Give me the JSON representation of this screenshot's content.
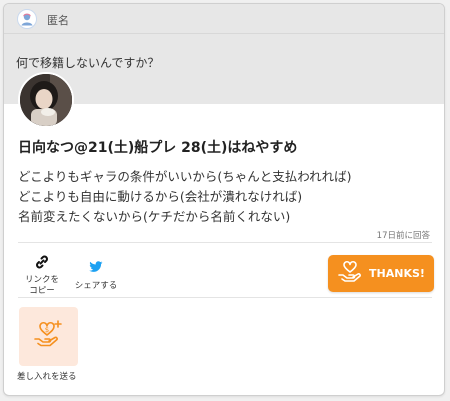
{
  "header": {
    "anonymous_name": "匿名",
    "avatar_icon": "anonymous-user-icon"
  },
  "question": {
    "text": "何で移籍しないんですか？"
  },
  "answer": {
    "avatar_icon": "user-photo-avatar",
    "name": "日向なつ@21(土)船プレ 28(土)はねやすめ",
    "lines": [
      "どこよりもギャラの条件がいいから(ちゃんと支払われれば)",
      "どこよりも自由に動けるから(会社が潰れなければ)",
      "名前変えたくないから(ケチだから名前くれない)"
    ],
    "answered_at": "17日前に回答"
  },
  "actions": {
    "copy_link": {
      "line1": "リンクを",
      "line2": "コピー",
      "icon": "link-icon"
    },
    "share": {
      "label": "シェアする",
      "icon": "twitter-icon"
    },
    "thanks": {
      "label": "THANKS!",
      "icon": "hand-heart-icon",
      "color": "#f5901f"
    }
  },
  "gift": {
    "label": "差し入れを送る",
    "icon": "heart-gift-icon",
    "bg_color": "#fde8dc"
  }
}
